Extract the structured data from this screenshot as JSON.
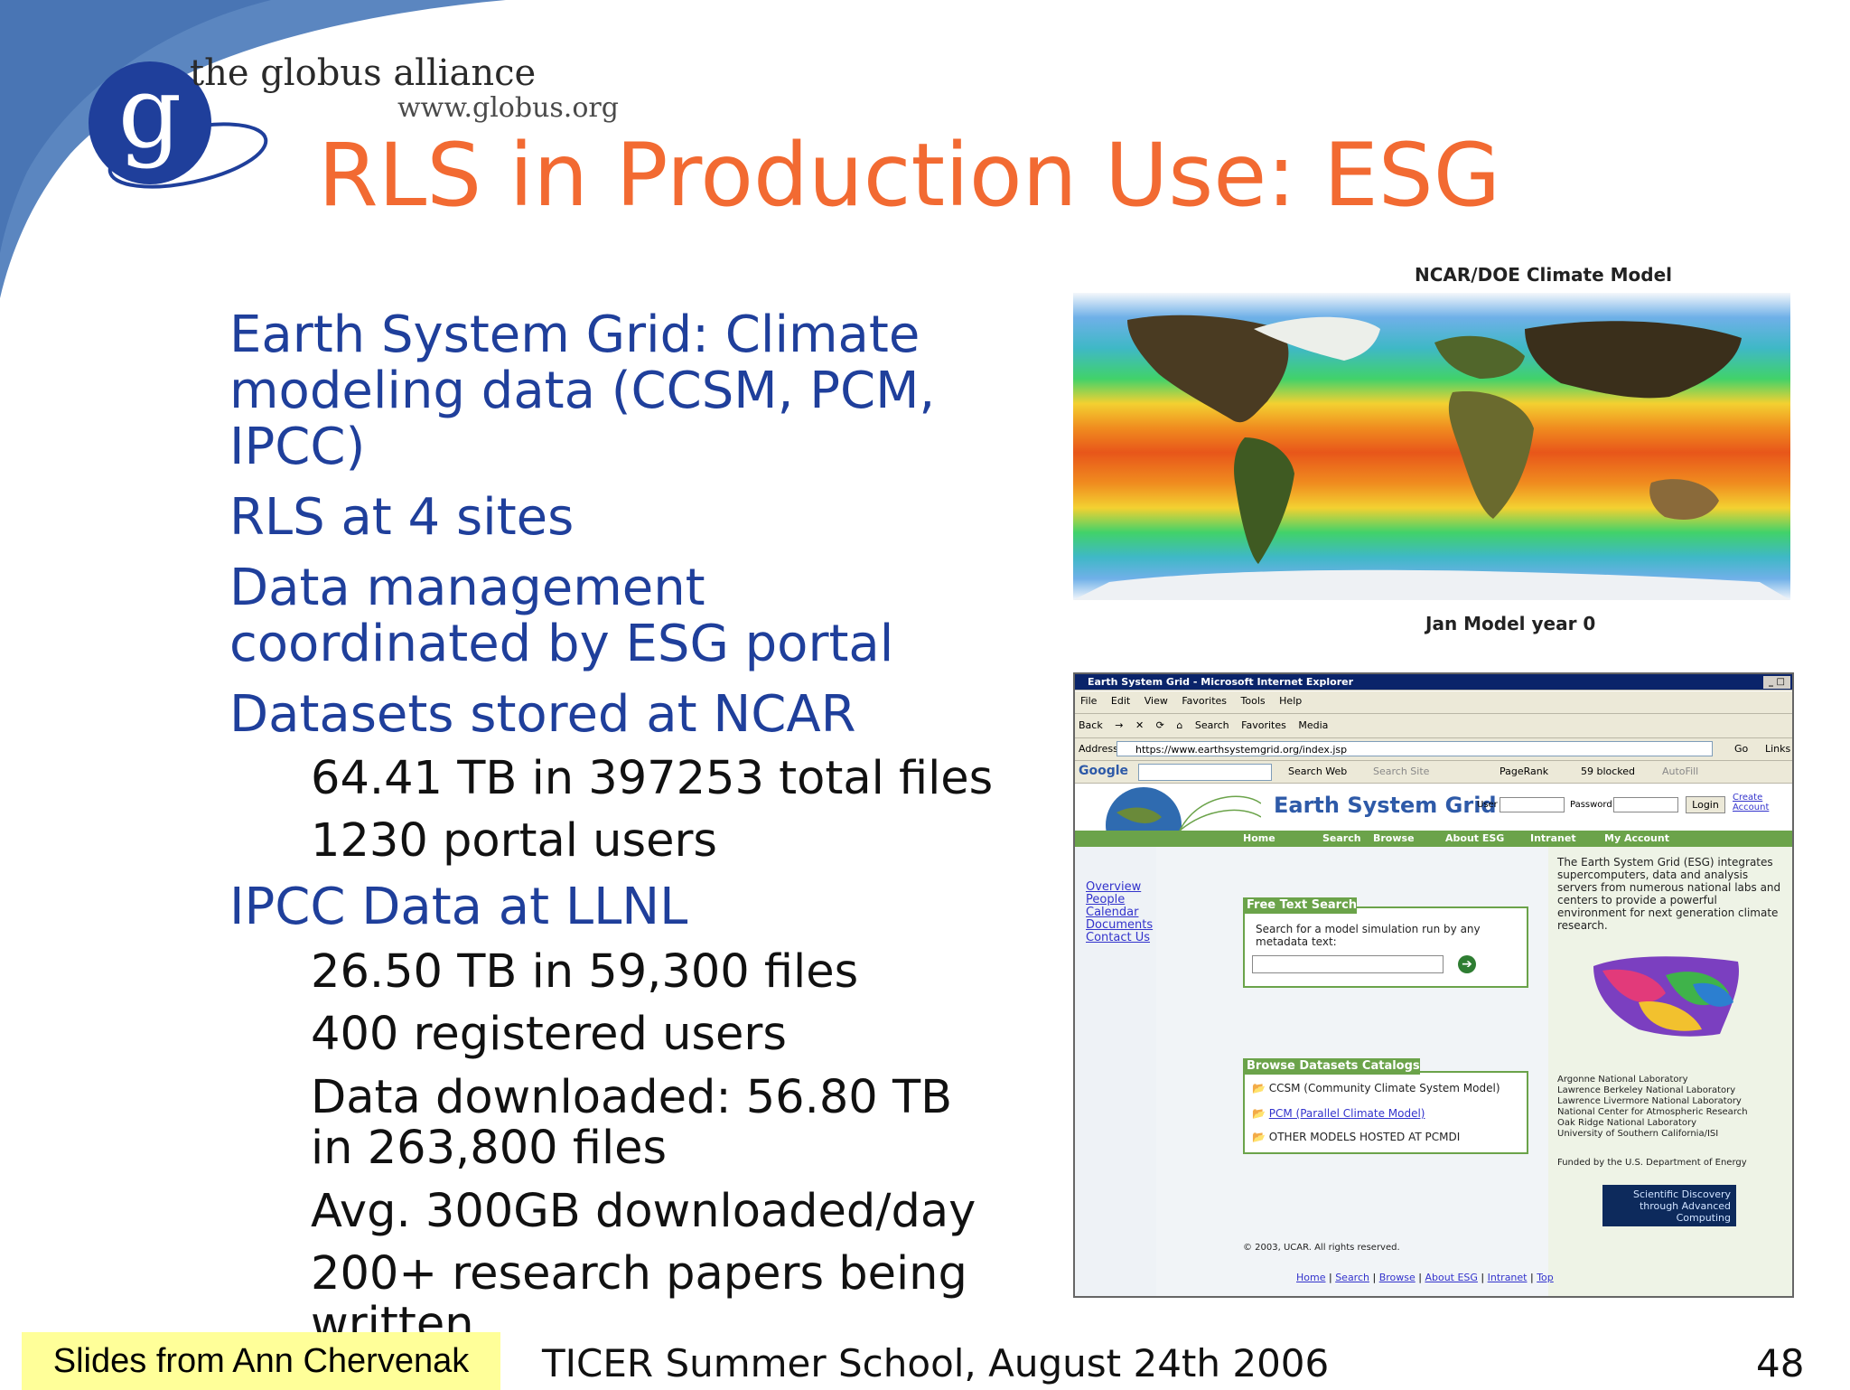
{
  "logo": {
    "org": "the globus alliance",
    "url": "www.globus.org",
    "letter": "g"
  },
  "title": "RLS in Production Use: ESG",
  "bullets": [
    {
      "level": 1,
      "text": "Earth System Grid: Climate"
    },
    {
      "level": 1,
      "text": "modeling data (CCSM, PCM,"
    },
    {
      "level": 1,
      "text": "IPCC)"
    },
    {
      "level": 1,
      "text": "RLS at 4 sites"
    },
    {
      "level": 1,
      "text": "Data management"
    },
    {
      "level": 1,
      "text": "coordinated by ESG portal"
    },
    {
      "level": 1,
      "text": "Datasets stored at NCAR"
    },
    {
      "level": 2,
      "text": "64.41 TB in 397253 total files"
    },
    {
      "level": 2,
      "text": "1230 portal users"
    },
    {
      "level": 1,
      "text": "IPCC Data at LLNL"
    },
    {
      "level": 2,
      "text": "26.50 TB in 59,300 files"
    },
    {
      "level": 2,
      "text": "400 registered users"
    },
    {
      "level": 2,
      "text": "Data downloaded: 56.80 TB"
    },
    {
      "level": 2,
      "text": "in 263,800 files"
    },
    {
      "level": 2,
      "text": "Avg. 300GB downloaded/day"
    },
    {
      "level": 2,
      "text": "200+ research papers being"
    },
    {
      "level": 2,
      "text": "written"
    }
  ],
  "climate_map": {
    "title": "NCAR/DOE Climate Model",
    "footer": "Jan  Model year   0"
  },
  "browser": {
    "window_title": "Earth System Grid - Microsoft Internet Explorer",
    "window_controls": "_ □",
    "menu": [
      "File",
      "Edit",
      "View",
      "Favorites",
      "Tools",
      "Help"
    ],
    "toolbar": [
      "Back",
      "→",
      "✕",
      "⟳",
      "⌂",
      "Search",
      "Favorites",
      "Media"
    ],
    "address_label": "Address",
    "address": "https://www.earthsystemgrid.org/index.jsp",
    "go": "Go",
    "links": "Links",
    "google": "Google",
    "google_tools": [
      "Search Web",
      "Search Site",
      "PageRank",
      "59 blocked",
      "AutoFill"
    ],
    "site": {
      "title": "Earth System Grid",
      "user_label": "User",
      "password_label": "Password",
      "login": "Login",
      "create_account": "Create Account",
      "nav": [
        "Home",
        "Search",
        "Browse",
        "About ESG",
        "Intranet",
        "My Account"
      ],
      "left_links": [
        "Overview",
        "People",
        "Calendar",
        "Documents",
        "Contact Us"
      ],
      "free_text_head": "Free Text Search",
      "free_text_desc": "Search for a model simulation run by any metadata text:",
      "browse_head": "Browse Datasets Catalogs",
      "catalogs": [
        "CCSM (Community Climate System Model)",
        "PCM (Parallel Climate Model)",
        "OTHER MODELS HOSTED AT PCMDI"
      ],
      "about_text": "The Earth System Grid (ESG) integrates supercomputers, data and analysis servers from numerous national labs and centers to provide a powerful environment for next generation climate research.",
      "labs": [
        "Argonne National Laboratory",
        "Lawrence Berkeley National Laboratory",
        "Lawrence Livermore National Laboratory",
        "National Center for Atmospheric Research",
        "Oak Ridge National Laboratory",
        "University of Southern California/ISI"
      ],
      "funded": "Funded by the U.S. Department of Energy",
      "scidac": "Scientific Discovery through Advanced Computing",
      "copyright": "© 2003, UCAR. All rights reserved.",
      "bottom_links": [
        "Home",
        "Search",
        "Browse",
        "About ESG",
        "Intranet",
        "Top"
      ]
    }
  },
  "credit": "Slides from Ann Chervenak",
  "footer": "TICER Summer School, August 24th 2006",
  "page_number": "48",
  "colors": {
    "title": "#f26a32",
    "bullet": "#1f3f9b",
    "corner": "#5b86c0",
    "esg_green": "#6ba34a"
  }
}
